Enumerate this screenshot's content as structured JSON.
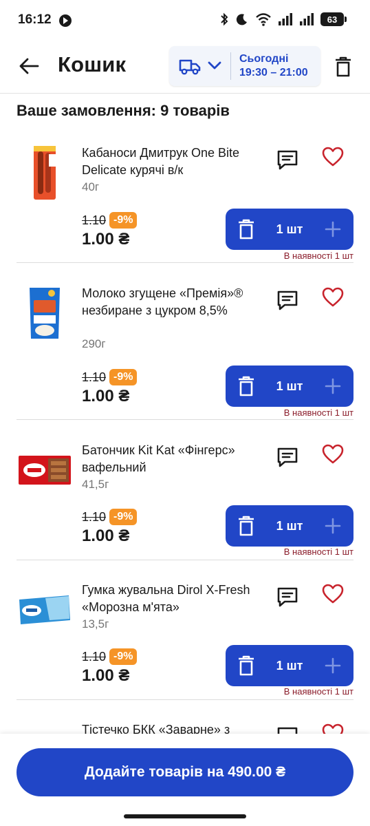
{
  "status_bar": {
    "time": "16:12",
    "battery": "63"
  },
  "header": {
    "title": "Кошик",
    "delivery": {
      "day": "Сьогодні",
      "time": "19:30 – 21:00"
    }
  },
  "order_title": "Ваше замовлення: 9 товарів",
  "products": [
    {
      "name": "Кабаноси Дмитрук One Bite Delicate курячі в/к",
      "weight": "40г",
      "old_price": "1.10",
      "discount": "-9%",
      "price": "1.00 ₴",
      "qty": "1 шт",
      "stock": "В наявності 1 шт"
    },
    {
      "name": "Молоко згущене «Премія»® незбиране з цукром 8,5%",
      "weight": "290г",
      "old_price": "1.10",
      "discount": "-9%",
      "price": "1.00 ₴",
      "qty": "1 шт",
      "stock": "В наявності 1 шт"
    },
    {
      "name": "Батончик Kit Kat «Фінгерс» вафельний",
      "weight": "41,5г",
      "old_price": "1.10",
      "discount": "-9%",
      "price": "1.00 ₴",
      "qty": "1 шт",
      "stock": "В наявності 1 шт"
    },
    {
      "name": "Гумка жувальна Dirol X-Fresh «Морозна м'ята»",
      "weight": "13,5г",
      "old_price": "1.10",
      "discount": "-9%",
      "price": "1.00 ₴",
      "qty": "1 шт",
      "stock": "В наявності 1 шт"
    },
    {
      "name": "Тістечко БКК «Заварне» з"
    }
  ],
  "cta": {
    "label": "Додайте товарів на 490.00 ₴"
  },
  "colors": {
    "accent": "#2146c7",
    "discount": "#f59427",
    "favorite": "#c8232c",
    "stock": "#8a1c2a"
  },
  "icons": [
    "back-arrow-icon",
    "delivery-truck-icon",
    "chevron-down-icon",
    "trash-icon",
    "comment-icon",
    "heart-icon",
    "plus-icon"
  ]
}
